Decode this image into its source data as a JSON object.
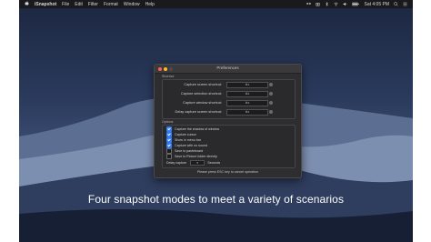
{
  "menubar": {
    "app_name": "iSnapshot",
    "menus": [
      "File",
      "Edit",
      "Filter",
      "Format",
      "Window",
      "Help"
    ],
    "clock": "Sat 4:05 PM",
    "status_icons": [
      "dropbox-icon",
      "camera-icon",
      "bluetooth-icon",
      "wifi-icon",
      "volume-icon",
      "battery-icon",
      "search-icon",
      "list-icon"
    ]
  },
  "window": {
    "title": "Preferences",
    "shortcut_section_label": "Shortcut",
    "shortcuts": [
      {
        "label": "Capture screen shortcut:",
        "value": "⌘1"
      },
      {
        "label": "Capture selection shortcut:",
        "value": "⌘2"
      },
      {
        "label": "Capture window shortcut:",
        "value": "⌘3"
      },
      {
        "label": "Delay capture screen shortcut:",
        "value": "⌘4"
      }
    ],
    "options_section_label": "Options",
    "options": [
      {
        "label": "Capture the shadow of window",
        "checked": true
      },
      {
        "label": "Capture cursor",
        "checked": true
      },
      {
        "label": "Show in menu bar",
        "checked": true
      },
      {
        "label": "Capture with no sound",
        "checked": true
      },
      {
        "label": "Save to pasteboard",
        "checked": false
      },
      {
        "label": "Save to Picture folder directly",
        "checked": false
      }
    ],
    "delay": {
      "label": "Delay capture",
      "value": "5",
      "unit": "Seconds"
    },
    "footer": "Please press ESC key to cancel operation"
  },
  "caption": "Four snapshot modes to meet a variety of scenarios",
  "colors": {
    "accent": "#2f7cf6",
    "window_bg": "#2e2e30",
    "menubar_bg": "#1a1a1e"
  }
}
